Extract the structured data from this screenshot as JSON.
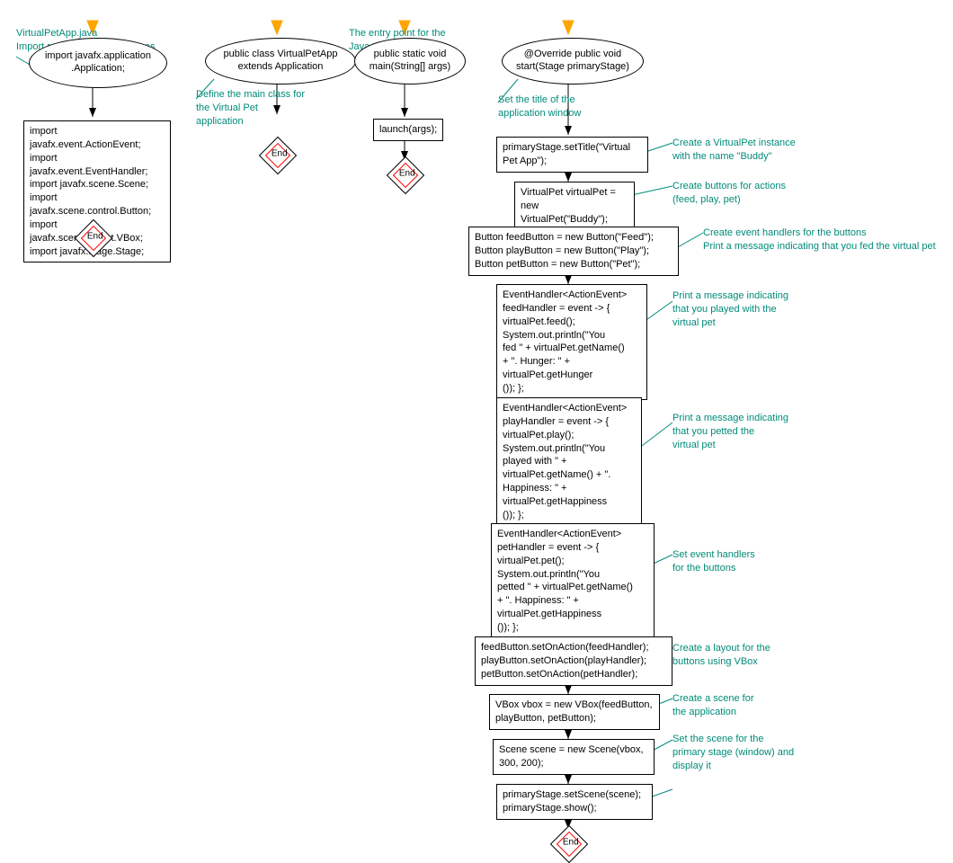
{
  "flow1": {
    "annot_top": "VirtualPetApp.java\nImport required JavaFX classes",
    "ellipse": "import javafx.application\n.Application;",
    "box": "import javafx.event.ActionEvent;\nimport javafx.event.EventHandler;\nimport javafx.scene.Scene;\nimport javafx.scene.control.Button;\nimport javafx.scene.layout.VBox;\nimport javafx.stage.Stage;",
    "end": "End"
  },
  "flow2": {
    "ellipse": "public class VirtualPetApp\nextends Application",
    "annot": "Define the main class for\nthe Virtual Pet\napplication",
    "end": "End"
  },
  "flow3": {
    "annot_top": "The entry point for the\nJava application",
    "ellipse": "public static void\nmain(String[] args)",
    "box": "launch(args);",
    "end": "End"
  },
  "flow4": {
    "ellipse": "@Override public void\nstart(Stage primaryStage)",
    "annot1": "Set the title of the\napplication window",
    "box1": "primaryStage.setTitle(\"Virtual\nPet App\");",
    "annot2": "Create a VirtualPet instance\nwith the name \"Buddy\"",
    "box2": "VirtualPet virtualPet =\nnew VirtualPet(\"Buddy\");",
    "annot3": "Create buttons for actions\n(feed, play, pet)",
    "box3": "Button feedButton = new Button(\"Feed\");\nButton playButton = new Button(\"Play\");\nButton petButton = new Button(\"Pet\");",
    "annot4": "Create event handlers for the buttons\nPrint a message indicating that you fed the virtual pet",
    "box4": "EventHandler<ActionEvent>\nfeedHandler = event -> {\nvirtualPet.feed();\nSystem.out.println(\"You\nfed \" + virtualPet.getName()\n+ \". Hunger: \" +\nvirtualPet.getHunger\n()); };",
    "annot5": "Print a message indicating\nthat you played with the\nvirtual pet",
    "box5": "EventHandler<ActionEvent>\nplayHandler = event -> {\nvirtualPet.play();\nSystem.out.println(\"You\nplayed with \" +\nvirtualPet.getName() + \".\nHappiness: \" +\nvirtualPet.getHappiness\n()); };",
    "annot6": "Print a message indicating\nthat you petted the\nvirtual pet",
    "box6": "EventHandler<ActionEvent>\npetHandler = event -> {\nvirtualPet.pet();\nSystem.out.println(\"You\npetted \" + virtualPet.getName()\n+ \". Happiness: \" +\nvirtualPet.getHappiness\n()); };",
    "annot7": "Set event handlers\nfor the buttons",
    "box7": "feedButton.setOnAction(feedHandler);\nplayButton.setOnAction(playHandler);\npetButton.setOnAction(petHandler);",
    "annot8": "Create a layout for the\nbuttons using VBox",
    "box8": "VBox vbox = new VBox(feedButton,\nplayButton, petButton);",
    "annot9": "Create a scene for\nthe application",
    "box9": "Scene scene = new Scene(vbox,\n300, 200);",
    "annot10": "Set the scene for the\nprimary stage (window) and\ndisplay it",
    "box10": "primaryStage.setScene(scene);\nprimaryStage.show();",
    "end": "End"
  }
}
